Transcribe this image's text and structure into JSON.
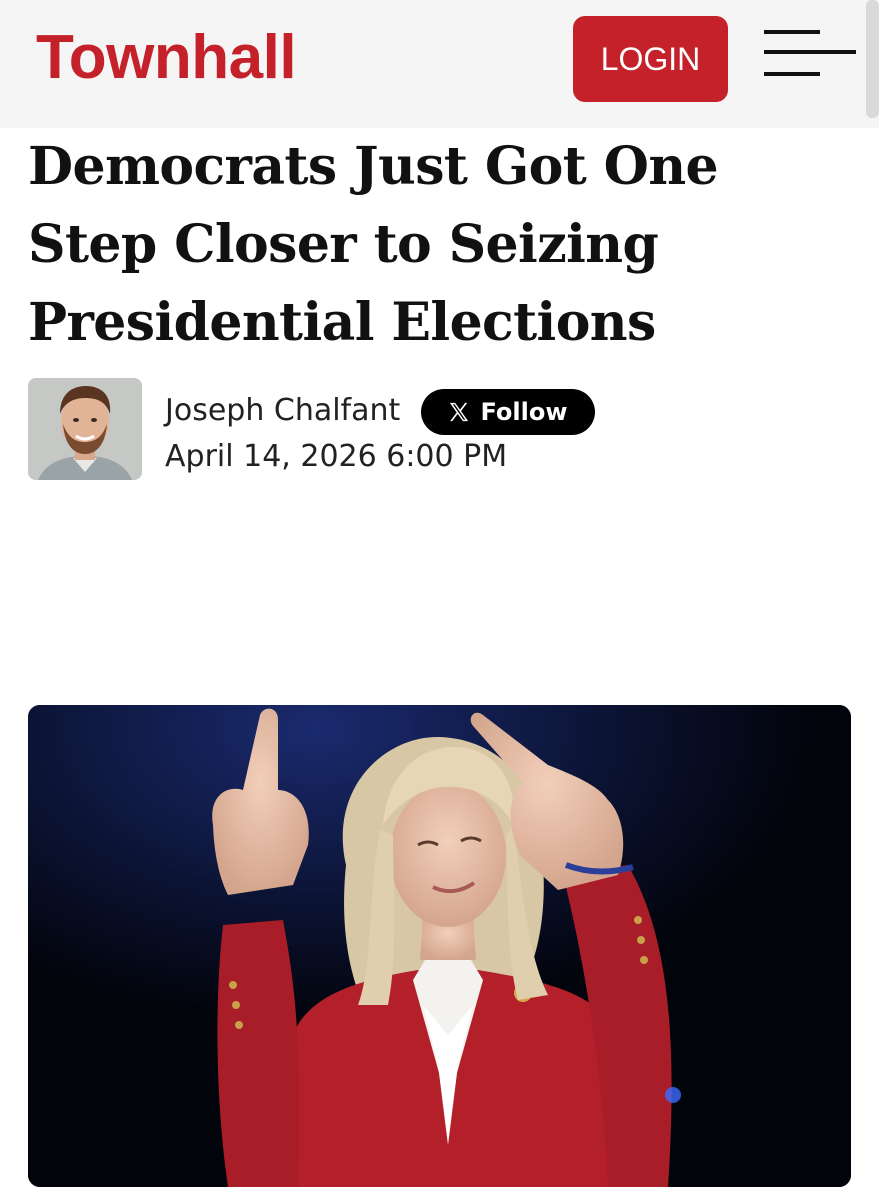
{
  "header": {
    "logo": "Townhall",
    "login_label": "LOGIN",
    "menu_icon": "hamburger-menu-icon",
    "brand_color": "#c4212a"
  },
  "article": {
    "headline": "Democrats Just Got One Step Closer to Seizing Presidential Elections",
    "author": {
      "name": "Joseph Chalfant",
      "follow_label": "Follow",
      "follow_icon": "x-logo-icon"
    },
    "date": "April 14, 2026 6:00 PM",
    "hero_image": "woman-in-red-blazer-pointing-up-photo"
  }
}
